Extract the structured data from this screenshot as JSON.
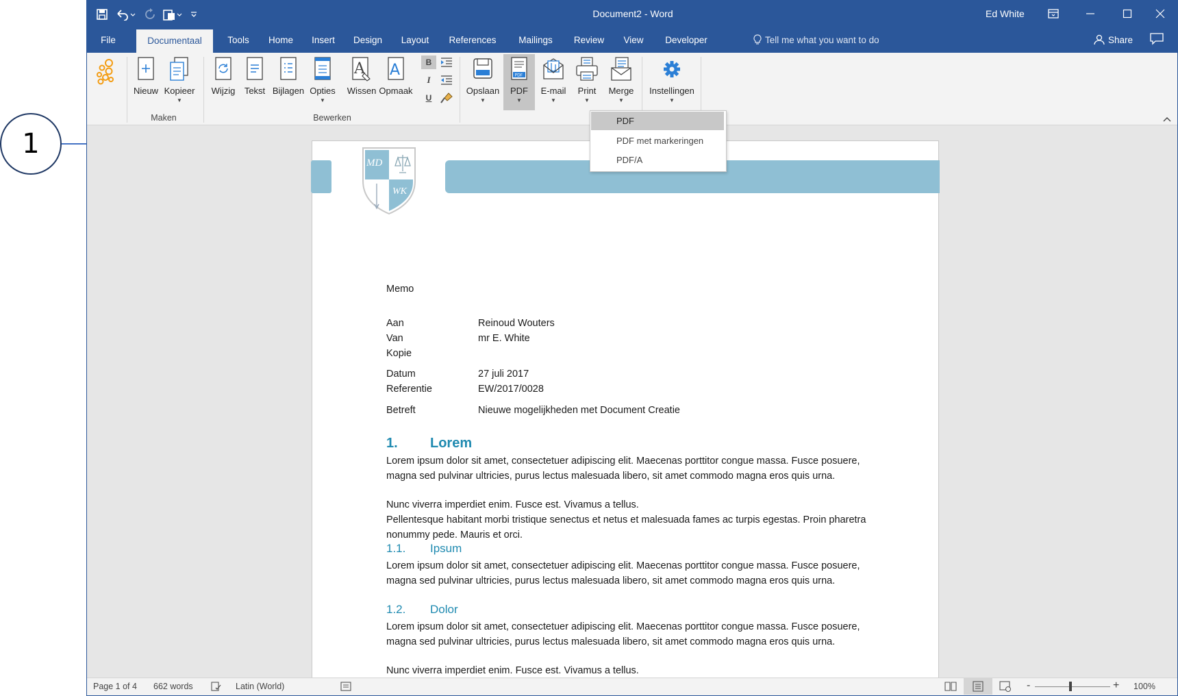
{
  "callout": {
    "number": "1"
  },
  "titlebar": {
    "document_title": "Document2 - Word",
    "user": "Ed White"
  },
  "tabs": [
    "File",
    "Documentaal",
    "Tools",
    "Home",
    "Insert",
    "Design",
    "Layout",
    "References",
    "Mailings",
    "Review",
    "View",
    "Developer"
  ],
  "active_tab": "Documentaal",
  "tell_me": "Tell me what you want to do",
  "share_label": "Share",
  "ribbon": {
    "groups": {
      "maken": "Maken",
      "bewerken": "Bewerken"
    },
    "buttons": {
      "nieuw": "Nieuw",
      "kopieer": "Kopieer",
      "wijzig": "Wijzig",
      "tekst": "Tekst",
      "bijlagen": "Bijlagen",
      "opties": "Opties",
      "wissen": "Wissen",
      "opmaak": "Opmaak",
      "opslaan": "Opslaan",
      "pdf": "PDF",
      "email": "E-mail",
      "print": "Print",
      "merge": "Merge",
      "instellingen": "Instellingen"
    },
    "format_buttons": {
      "bold": "B",
      "italic": "I",
      "underline": "U"
    }
  },
  "pdf_menu": {
    "items": [
      "PDF",
      "PDF met markeringen",
      "PDF/A"
    ]
  },
  "document": {
    "logo": {
      "tl": "MD",
      "br": "WK"
    },
    "memo": "Memo",
    "fields": [
      {
        "label": "Aan",
        "value": "Reinoud Wouters"
      },
      {
        "label": "Van",
        "value": "mr E. White"
      },
      {
        "label": "Kopie",
        "value": ""
      },
      {
        "label": "Datum",
        "value": "27 juli 2017"
      },
      {
        "label": "Referentie",
        "value": "EW/2017/0028"
      },
      {
        "label": "Betreft",
        "value": "Nieuwe mogelijkheden met Document Creatie"
      }
    ],
    "h1": {
      "num": "1.",
      "text": "Lorem"
    },
    "p1": "Lorem ipsum dolor sit amet, consectetuer adipiscing elit. Maecenas porttitor congue massa. Fusce posuere, magna sed pulvinar ultricies, purus lectus malesuada libero, sit amet commodo magna eros quis urna.",
    "p2": "Nunc viverra imperdiet enim. Fusce est. Vivamus a tellus.",
    "p3": "Pellentesque habitant morbi tristique senectus et netus et malesuada fames ac turpis egestas. Proin pharetra nonummy pede. Mauris et orci.",
    "h11": {
      "num": "1.1.",
      "text": "Ipsum"
    },
    "p4": "Lorem ipsum dolor sit amet, consectetuer adipiscing elit. Maecenas porttitor congue massa. Fusce posuere, magna sed pulvinar ultricies, purus lectus malesuada libero, sit amet commodo magna eros quis urna.",
    "h12": {
      "num": "1.2.",
      "text": "Dolor"
    },
    "p5": "Lorem ipsum dolor sit amet, consectetuer adipiscing elit. Maecenas porttitor congue massa. Fusce posuere, magna sed pulvinar ultricies, purus lectus malesuada libero, sit amet commodo magna eros quis urna.",
    "p6": "Nunc viverra imperdiet enim. Fusce est. Vivamus a tellus."
  },
  "statusbar": {
    "page": "Page 1 of 4",
    "words": "662 words",
    "language": "Latin (World)",
    "zoom": "100%",
    "zoom_minus": "-",
    "zoom_plus": "+"
  },
  "colors": {
    "word_blue": "#2b579a",
    "heading": "#1f8ab0",
    "band": "#8fbfd4",
    "callout_line": "#4472c4"
  }
}
